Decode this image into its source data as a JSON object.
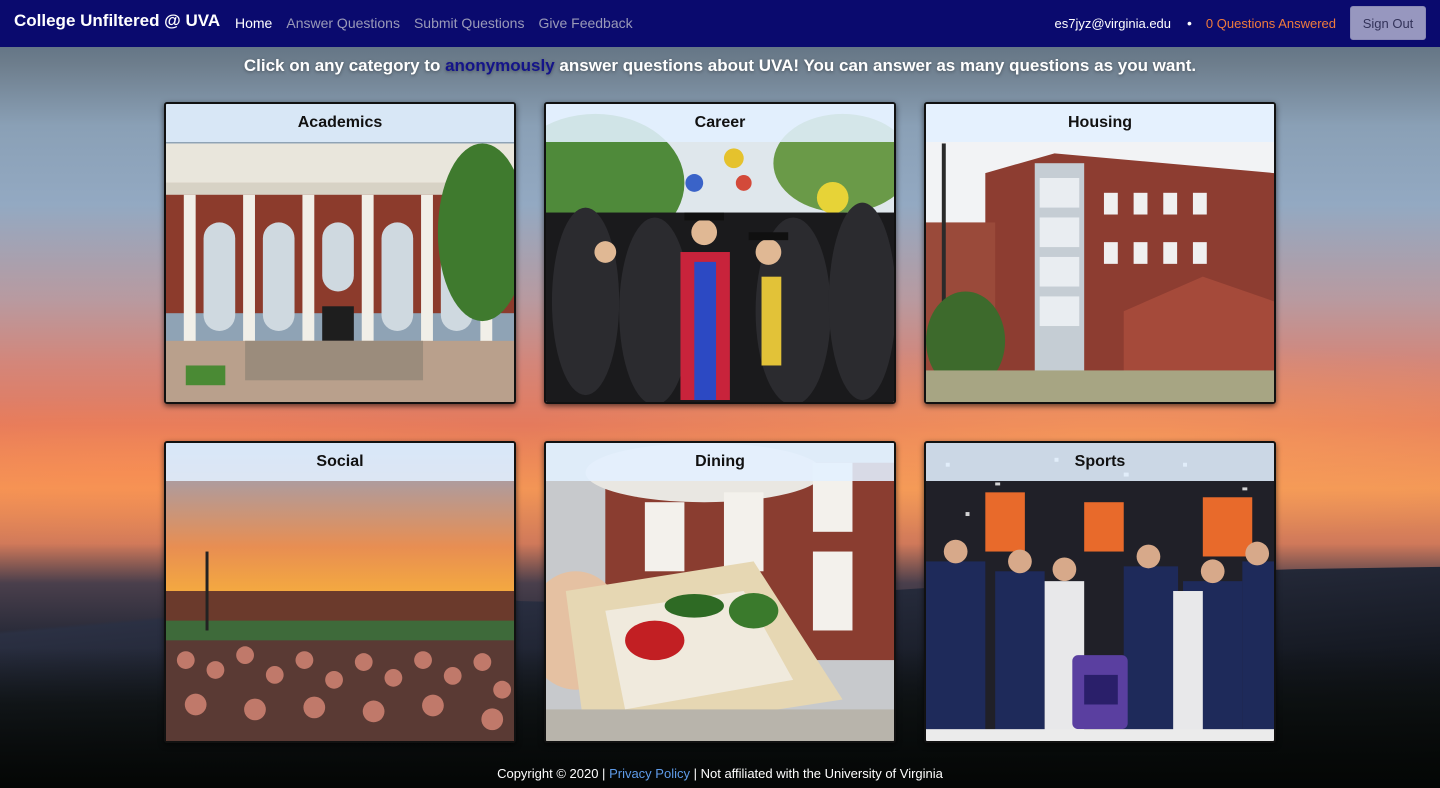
{
  "nav": {
    "brand": "College Unfiltered @ UVA",
    "links": [
      "Home",
      "Answer Questions",
      "Submit Questions",
      "Give Feedback"
    ],
    "user_email": "es7jyz@virginia.edu",
    "separator": "•",
    "answered_count": "0 Questions Answered",
    "sign_out": "Sign Out"
  },
  "headline": {
    "before": "Click on any category to",
    "emphasis": "anonymously",
    "after": "answer questions about UVA! You can answer as many questions as you want."
  },
  "categories": [
    {
      "label": "Academics"
    },
    {
      "label": "Career"
    },
    {
      "label": "Housing"
    },
    {
      "label": "Social"
    },
    {
      "label": "Dining"
    },
    {
      "label": "Sports"
    }
  ],
  "footer": {
    "copyright": "Copyright © 2020 |",
    "privacy": "Privacy Policy",
    "note": "| Not affiliated with the University of Virginia"
  },
  "colors": {
    "navbar": "#0a0a6e",
    "answered": "#f07b3c",
    "emphasis": "#14148a",
    "link": "#5f9be8"
  }
}
